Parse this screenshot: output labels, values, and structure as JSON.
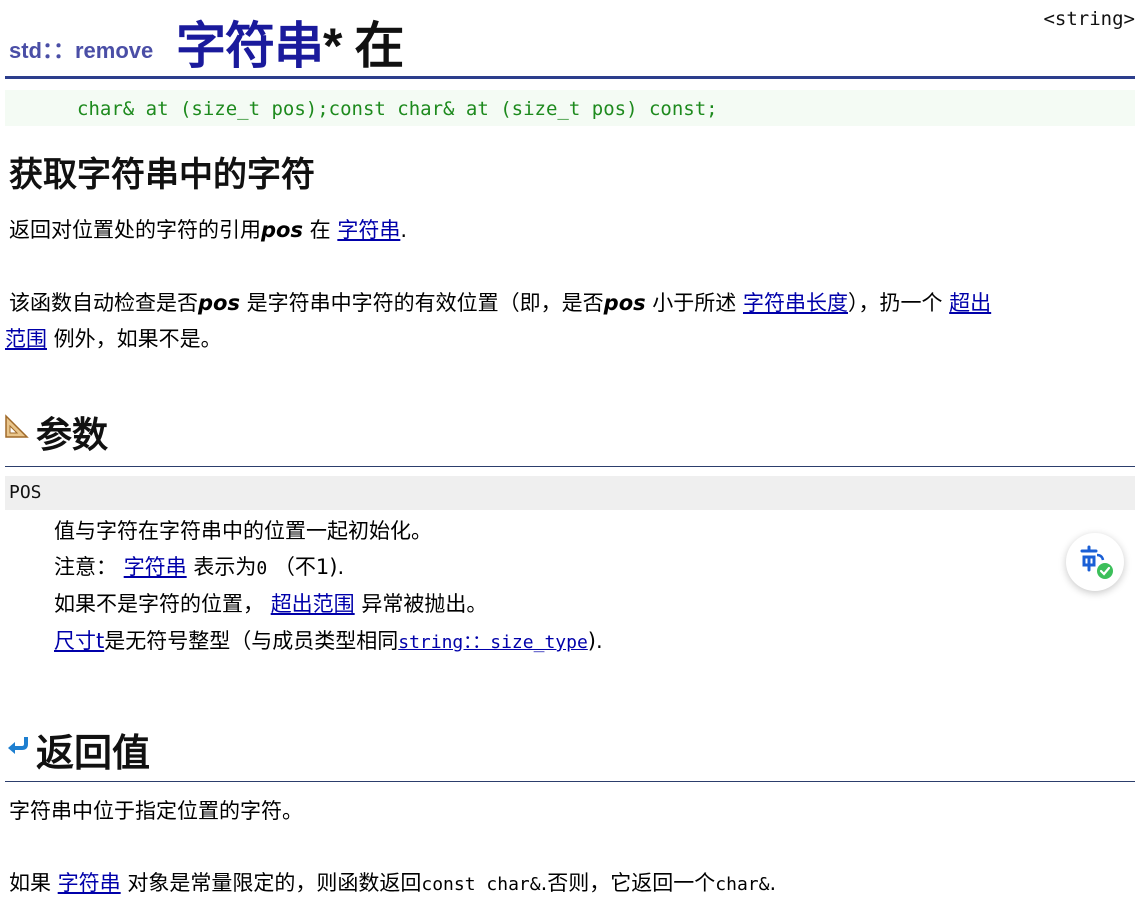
{
  "header": {
    "namespace": "std：：remove",
    "title_blue": "字符串",
    "title_sep": "*",
    "title_black": "在",
    "header_tag": "<string>"
  },
  "prototype": "char& at (size_t pos);const char& at (size_t pos) const;",
  "heading_main": "获取字符串中的字符",
  "desc1": {
    "prefix": "返回对位置处的字符的引用",
    "param": "pos",
    "mid": " 在 ",
    "link": "字符串",
    "suffix": "."
  },
  "desc2": {
    "t1": "该函数自动检查是否",
    "param1": "pos",
    "t2": " 是字符串中字符的有效位置（即，是否",
    "param2": "pos",
    "t3": " 小于所述 ",
    "link1": "字符串长度",
    "t4": "），扔一个 ",
    "link2a": "超出",
    "link2b": "范围",
    "t5": " 例外，如果不是。"
  },
  "params_section": {
    "heading": "参数",
    "param_name": "POS",
    "line1": "值与字符在字符串中的位置一起初始化。",
    "line2_prefix": "注意：",
    "line2_link": "字符串",
    "line2_mid": "表示为",
    "line2_code": "0",
    "line2_suffix": "（不1).",
    "line3_prefix": "如果不是字符的位置，",
    "line3_link": "超出范围",
    "line3_suffix": "异常被抛出。",
    "line4_link": "尺寸t",
    "line4_mid": "是无符号整型（与成员类型相同",
    "line4_code": "string：：size_type",
    "line4_suffix": ")."
  },
  "return_section": {
    "heading": "返回值",
    "line1": "字符串中位于指定位置的字符。",
    "line2_prefix": "如果 ",
    "line2_link": "字符串",
    "line2_mid": " 对象是常量限定的，则函数返回",
    "line2_code1": "const char&",
    "line2_mid2": ".否则，它返回一个",
    "line2_code2": "char&",
    "line2_suffix": "."
  },
  "icons": {
    "params_icon": "ruler-triangle-icon",
    "return_icon": "return-arrow-icon",
    "translate_fab": "translate-icon"
  },
  "colors": {
    "accent": "#2c3e8c",
    "link": "#0000aa",
    "title_blue": "#1a1a9c",
    "code_green": "#1d8a1d"
  }
}
